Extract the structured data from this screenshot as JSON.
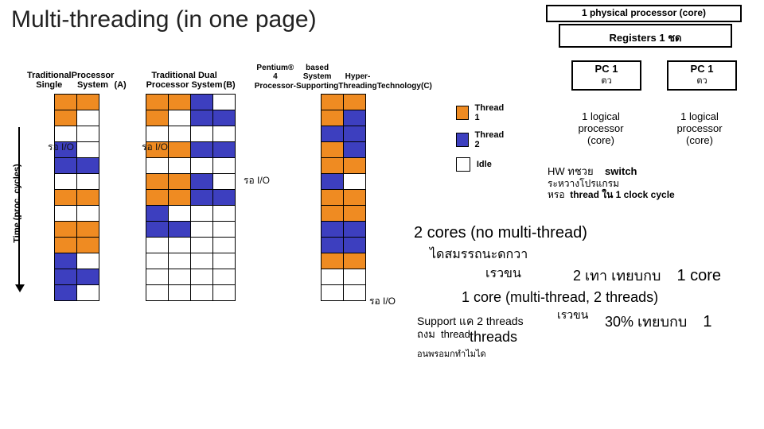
{
  "title": "Multi-threading (in one page)",
  "diagram": {
    "y_axis_label": "Time (proc. cycles)",
    "columns": {
      "a": {
        "heading": [
          "Traditional Single",
          "Processor System",
          "(A)"
        ]
      },
      "b": {
        "heading": [
          "Traditional Dual Processor System",
          "(B)"
        ]
      },
      "c": {
        "heading": [
          "Pentium® 4 Processor-",
          "based System Supporting",
          "Hyper-Threading",
          "Technology",
          "(C)"
        ]
      }
    },
    "wait_io_label_a": "รอ I/O",
    "wait_io_label_b": "รอ I/O",
    "wait_io_label_c": "รอ I/O",
    "legend": {
      "t1": "Thread 1",
      "t2": "Thread 2",
      "idle": "Idle"
    }
  },
  "right": {
    "phys_core": "1 physical processor (core)",
    "registers": "Registers 1 ชด",
    "pc1_label": "PC 1",
    "pc1_sub": "ตว",
    "pc2_label": "PC 1",
    "pc2_sub": "ตว",
    "logical_a": [
      "1 logical",
      "processor",
      "(core)"
    ],
    "logical_b": [
      "1 logical",
      "processor",
      "(core)"
    ],
    "hw": {
      "l1_a": "HW ทชวย",
      "l1_b": "switch",
      "l2": "ระหวางโปรแกรม",
      "l3_a": "หรอ",
      "l3_b": "thread ใน 1 clock cycle"
    }
  },
  "bottom": {
    "cores_nomt": "2 cores (no multi-thread)",
    "perf_line": "ไดสมรรถนะดกวา",
    "fast1": "เรวขน",
    "cmp1_a": "2 เทา  เทยบกบ",
    "cmp1_b": "1 core",
    "mt_title": "1 core (multi-thread, 2 threads)",
    "io2": "รอ I/O",
    "support_a": "Support แค",
    "support_b": "2 threads",
    "fast2": "เรวขน",
    "cmp2_a": "30% เทยบกบ",
    "cmp2_b": "1",
    "limit_a": "ถงม",
    "limit_b": "thread",
    "threads2": "threads",
    "other": "อนพรอมกทำไมได"
  },
  "chart_data": {
    "type": "table",
    "description": "Three execution-timeline grids (A=single core, B=dual core, C=hyper-threading). Rows advance in time; o=Thread1 (orange), b=Thread2 (blue), w=Idle.",
    "columns_per_grid": {
      "A": 2,
      "B": 4,
      "C": 2
    },
    "rows": 13,
    "A": [
      [
        "o",
        "o"
      ],
      [
        "o",
        "w"
      ],
      [
        "w",
        "w"
      ],
      [
        "b",
        "w"
      ],
      [
        "b",
        "b"
      ],
      [
        "w",
        "w"
      ],
      [
        "o",
        "o"
      ],
      [
        "w",
        "w"
      ],
      [
        "o",
        "o"
      ],
      [
        "o",
        "o"
      ],
      [
        "b",
        "w"
      ],
      [
        "b",
        "b"
      ],
      [
        "b",
        "w"
      ]
    ],
    "B": [
      [
        "o",
        "o",
        "b",
        "w"
      ],
      [
        "o",
        "w",
        "b",
        "b"
      ],
      [
        "w",
        "w",
        "w",
        "w"
      ],
      [
        "o",
        "o",
        "b",
        "b"
      ],
      [
        "w",
        "w",
        "w",
        "w"
      ],
      [
        "o",
        "o",
        "b",
        "w"
      ],
      [
        "o",
        "o",
        "b",
        "b"
      ],
      [
        "b",
        "w",
        "w",
        "w"
      ],
      [
        "b",
        "b",
        "w",
        "w"
      ],
      [
        "w",
        "w",
        "w",
        "w"
      ],
      [
        "w",
        "w",
        "w",
        "w"
      ],
      [
        "w",
        "w",
        "w",
        "w"
      ],
      [
        "w",
        "w",
        "w",
        "w"
      ]
    ],
    "C": [
      [
        "o",
        "o"
      ],
      [
        "o",
        "b"
      ],
      [
        "b",
        "b"
      ],
      [
        "o",
        "b"
      ],
      [
        "o",
        "o"
      ],
      [
        "b",
        "w"
      ],
      [
        "o",
        "o"
      ],
      [
        "o",
        "o"
      ],
      [
        "b",
        "b"
      ],
      [
        "b",
        "b"
      ],
      [
        "o",
        "o"
      ],
      [
        "w",
        "w"
      ],
      [
        "w",
        "w"
      ]
    ]
  }
}
